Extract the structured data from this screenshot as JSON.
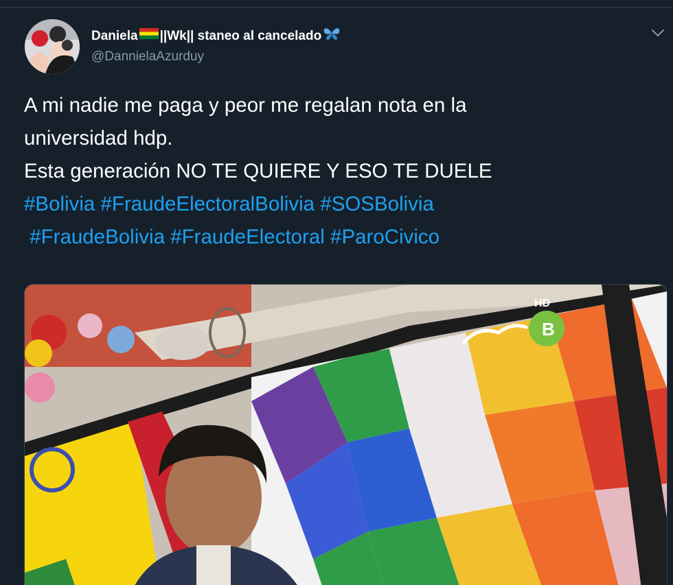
{
  "tweet": {
    "display_name_part1": "Daniela",
    "display_name_part2": "||Wk|| staneo al cancelado",
    "handle": "@DannielaAzurduy",
    "text_lines": [
      "A mi nadie me paga y peor me regalan nota en la",
      "universidad hdp.",
      "Esta generación NO TE QUIERE Y ESO TE DUELE"
    ],
    "hashtags_line1": [
      "#Bolivia",
      "#FraudeElectoralBolivia",
      "#SOSBolivia"
    ],
    "hashtags_line2": [
      "#FraudeBolivia",
      "#FraudeElectoral",
      "#ParoCivico"
    ],
    "media_logo_text": "HD"
  },
  "icons": {
    "flag": "bolivia-flag-emoji",
    "butterfly": "butterfly-emoji",
    "chevron": "chevron-down-icon"
  },
  "colors": {
    "background": "#15202b",
    "text": "#ffffff",
    "secondary": "#8899a6",
    "link": "#1da1f2"
  }
}
